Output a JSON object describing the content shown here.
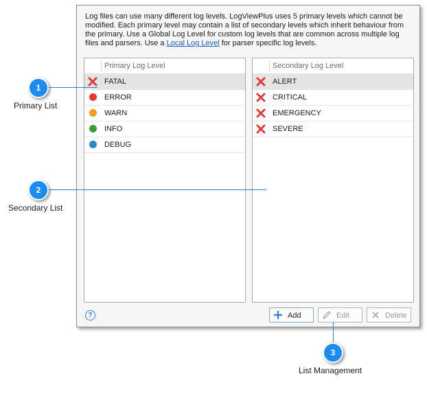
{
  "description": {
    "text_before_link": "Log files can use many different log levels.  LogViewPlus uses 5 primary levels which cannot be modified.  Each primary level may contain a list of secondary levels which inherit behaviour from the primary.  Use a Global Log Level for custom log levels that are common across multiple log files and parsers.  Use a ",
    "link": "Local Log Level",
    "text_after_link": " for parser specific log levels."
  },
  "primary_list": {
    "header": "Primary Log Level",
    "items": [
      {
        "label": "FATAL",
        "icon": "x-icon",
        "color": "#e03a3a",
        "selected": true
      },
      {
        "label": "ERROR",
        "icon": "dot-icon",
        "color": "#e53935",
        "selected": false
      },
      {
        "label": "WARN",
        "icon": "dot-icon",
        "color": "#f39a2b",
        "selected": false
      },
      {
        "label": "INFO",
        "icon": "dot-icon",
        "color": "#3c9a3c",
        "selected": false
      },
      {
        "label": "DEBUG",
        "icon": "dot-icon",
        "color": "#2a87c8",
        "selected": false
      }
    ]
  },
  "secondary_list": {
    "header": "Secondary Log Level",
    "items": [
      {
        "label": "ALERT",
        "icon": "x-icon",
        "selected": true
      },
      {
        "label": "CRITICAL",
        "icon": "x-icon",
        "selected": false
      },
      {
        "label": "EMERGENCY",
        "icon": "x-icon",
        "selected": false
      },
      {
        "label": "SEVERE",
        "icon": "x-icon",
        "selected": false
      }
    ]
  },
  "buttons": {
    "add": "Add",
    "edit": "Edit",
    "delete": "Delete"
  },
  "help": "?",
  "callouts": [
    {
      "number": "1",
      "label": "Primary List"
    },
    {
      "number": "2",
      "label": "Secondary List"
    },
    {
      "number": "3",
      "label": "List Management"
    }
  ],
  "colors": {
    "accent": "#1c8cf0",
    "error_x": "#e03a3a",
    "link": "#1a5fb4"
  }
}
